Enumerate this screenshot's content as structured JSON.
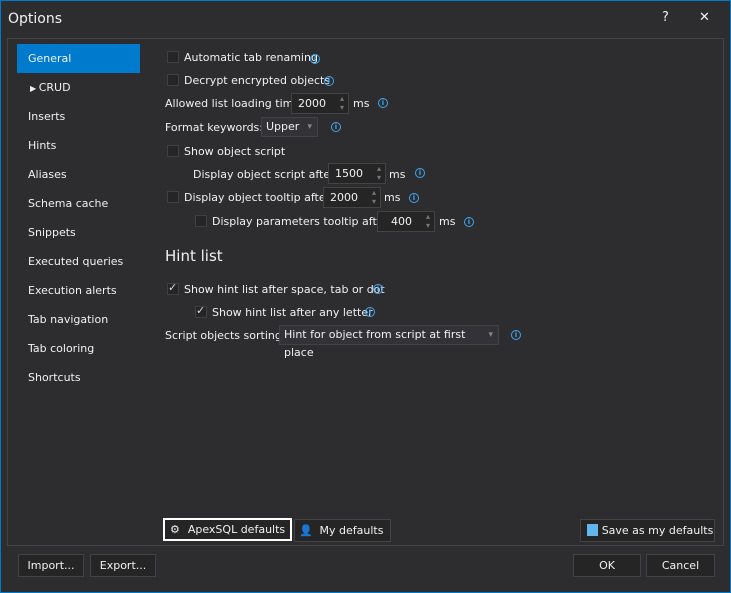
{
  "window": {
    "title": "Options",
    "help": "?",
    "close": "✕"
  },
  "nav": [
    "General",
    "CRUD",
    "Inserts",
    "Hints",
    "Aliases",
    "Schema cache",
    "Snippets",
    "Executed queries",
    "Execution alerts",
    "Tab navigation",
    "Tab coloring",
    "Shortcuts"
  ],
  "general": {
    "auto_tab": "Automatic tab renaming",
    "decrypt": "Decrypt encrypted objects",
    "list_time_label": "Allowed list loading time:",
    "list_time": "2000",
    "ms": "ms",
    "format_label": "Format keywords:",
    "format": "Upper",
    "show_script": "Show object script",
    "script_after_label": "Display object script after:",
    "script_after": "1500",
    "tooltip_label": "Display object tooltip after:",
    "tooltip": "2000",
    "params_label": "Display parameters tooltip after:",
    "params": "400"
  },
  "hint": {
    "heading": "Hint list",
    "after_space": "Show hint list after space, tab or dot",
    "after_letter": "Show hint list after any letter",
    "sort_label": "Script objects sorting:",
    "sort": "Hint for object from script at first place"
  },
  "buttons": {
    "apex": "ApexSQL defaults",
    "my": "My defaults",
    "save": "Save as my defaults",
    "import": "Import...",
    "export": "Export...",
    "ok": "OK",
    "cancel": "Cancel"
  }
}
